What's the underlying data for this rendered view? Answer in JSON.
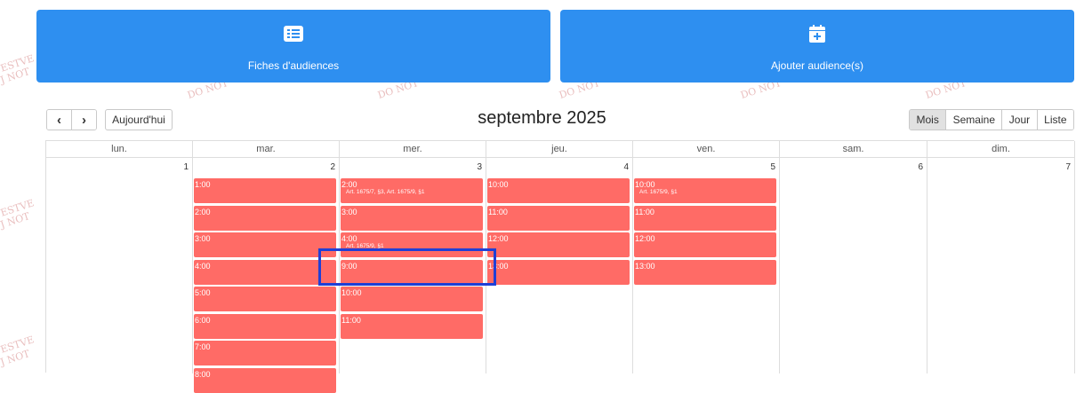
{
  "watermark": {
    "side": [
      "ESTVE",
      "J NOT"
    ],
    "row": "DO NOT"
  },
  "buttons": {
    "hearings_list": {
      "label": "Fiches d'audiences",
      "icon": "list-icon"
    },
    "add_hearing": {
      "label": "Ajouter audience(s)",
      "icon": "calendar-plus-icon"
    }
  },
  "toolbar": {
    "prev_label": "‹",
    "next_label": "›",
    "today_label": "Aujourd'hui",
    "title": "septembre 2025",
    "views": {
      "month": "Mois",
      "week": "Semaine",
      "day": "Jour",
      "list": "Liste"
    },
    "active_view": "Mois"
  },
  "calendar": {
    "weekdays": [
      "lun.",
      "mar.",
      "mer.",
      "jeu.",
      "ven.",
      "sam.",
      "dim."
    ],
    "day_numbers": [
      "1",
      "2",
      "3",
      "4",
      "5",
      "6",
      "7"
    ],
    "event_color": "#ff6b66",
    "days": [
      {
        "events": []
      },
      {
        "events": [
          {
            "time": "1:00",
            "desc": ""
          },
          {
            "time": "2:00",
            "desc": ""
          },
          {
            "time": "3:00",
            "desc": ""
          },
          {
            "time": "4:00",
            "desc": ""
          },
          {
            "time": "5:00",
            "desc": ""
          },
          {
            "time": "6:00",
            "desc": ""
          },
          {
            "time": "7:00",
            "desc": ""
          },
          {
            "time": "8:00",
            "desc": ""
          }
        ]
      },
      {
        "events": [
          {
            "time": "2:00",
            "desc": "Art. 1675/7, §3, Art. 1675/9, §1"
          },
          {
            "time": "3:00",
            "desc": ""
          },
          {
            "time": "4:00",
            "desc": "Art. 1675/9, §1"
          },
          {
            "time": "9:00",
            "desc": ""
          },
          {
            "time": "10:00",
            "desc": ""
          },
          {
            "time": "11:00",
            "desc": ""
          }
        ]
      },
      {
        "events": [
          {
            "time": "10:00",
            "desc": ""
          },
          {
            "time": "11:00",
            "desc": ""
          },
          {
            "time": "12:00",
            "desc": ""
          },
          {
            "time": "13:00",
            "desc": ""
          }
        ]
      },
      {
        "events": [
          {
            "time": "10:00",
            "desc": "Art. 1675/9, §1"
          },
          {
            "time": "11:00",
            "desc": ""
          },
          {
            "time": "12:00",
            "desc": ""
          },
          {
            "time": "13:00",
            "desc": ""
          }
        ]
      },
      {
        "events": []
      },
      {
        "events": []
      }
    ]
  }
}
